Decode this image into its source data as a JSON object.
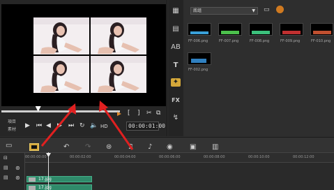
{
  "preview": {
    "mode_label_project": "項目",
    "mode_label_clip": "素材",
    "timecode": "00:00:01:00",
    "hd_label": "HD",
    "scrub_position": 0.31
  },
  "library": {
    "dropdown_value": "底组",
    "thumbnails": [
      {
        "label": "FF-006.png",
        "color": "#3aa0d8"
      },
      {
        "label": "FF-007.png",
        "color": "#4cc04c"
      },
      {
        "label": "FF-008.png",
        "color": "#3cc07c"
      },
      {
        "label": "FF-009.png",
        "color": "#c03030"
      },
      {
        "label": "FF-010.png",
        "color": "#c05030"
      },
      {
        "label": "FF-002.png",
        "color": "#3080c0"
      }
    ]
  },
  "timeline": {
    "ruler_ticks": [
      "00:00:00:00",
      "00:00:02:00",
      "00:00:04:00",
      "00:00:06:00",
      "00:00:08:00",
      "00:00:10:00",
      "00:00:12:00"
    ],
    "clips": [
      {
        "name": "17.jpg"
      },
      {
        "name": "17.jpg"
      }
    ]
  }
}
